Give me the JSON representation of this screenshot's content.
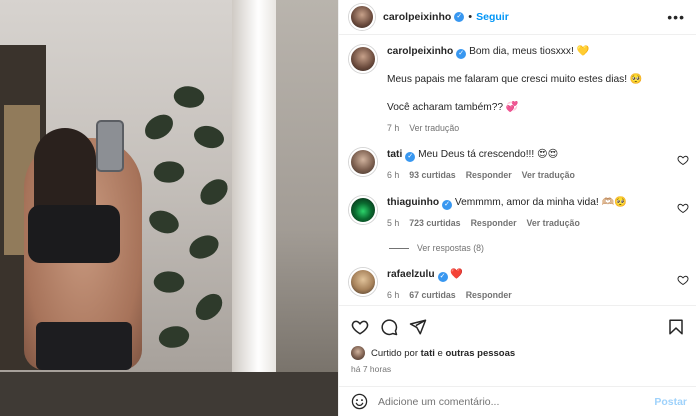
{
  "post": {
    "username": "carolpeixinho",
    "follow_label": "Seguir",
    "more_label": "•••"
  },
  "caption": {
    "username": "carolpeixinho",
    "line1": "Bom dia, meus tiosxxx! 💛",
    "line2": "Meus papais me falaram que cresci muito estes dias! 🥺",
    "line3": "Você acharam também?? 💞",
    "time": "7 h",
    "translate": "Ver tradução"
  },
  "comments": [
    {
      "username": "tati",
      "text": "Meu Deus tá crescendo!!! 😍😍",
      "time": "6 h",
      "likes": "93 curtidas",
      "reply": "Responder",
      "translate": "Ver tradução"
    },
    {
      "username": "thiaguinho",
      "text": "Vemmmm, amor da minha vida! 🫶🏼🥺",
      "time": "5 h",
      "likes": "723 curtidas",
      "reply": "Responder",
      "translate": "Ver tradução"
    },
    {
      "username": "rafaelzulu",
      "text": "❤️",
      "time": "6 h",
      "likes": "67 curtidas",
      "reply": "Responder"
    }
  ],
  "view_replies": "Ver respostas (8)",
  "liked_by": {
    "prefix": "Curtido por",
    "user": "tati",
    "connector": "e",
    "others": "outras pessoas"
  },
  "post_time": "há 7 horas",
  "composer": {
    "placeholder": "Adicione um comentário...",
    "post_label": "Postar"
  },
  "colors": {
    "accent": "#0095f6",
    "verified": "#3897f0",
    "muted": "#737373",
    "heart_red": "#ed4956"
  },
  "icons": [
    "verified-icon",
    "more-icon",
    "heart-icon",
    "comment-icon",
    "share-icon",
    "bookmark-icon",
    "emoji-icon"
  ]
}
